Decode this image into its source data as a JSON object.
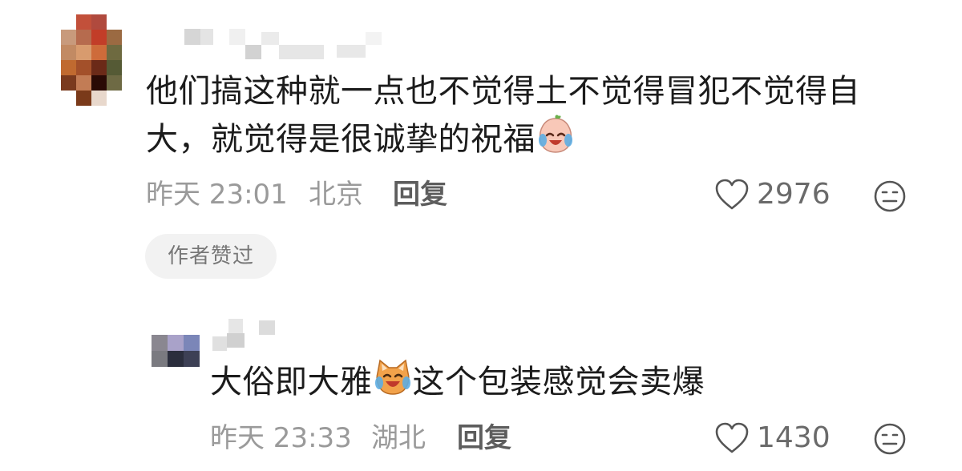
{
  "comment": {
    "text_line1": "他们搞这种就一点也不觉得土不觉得冒犯不觉得自",
    "text_line2": "大，就觉得是很诚挚的祝福",
    "emoji": "crying-laughing-peach-emoji",
    "time": "昨天 23:01",
    "location": "北京",
    "reply_label": "回复",
    "like_count": "2976",
    "author_badge": "作者赞过"
  },
  "reply": {
    "text_before_emoji": "大俗即大雅",
    "emoji": "crying-laughing-cat-emoji",
    "text_after_emoji": "这个包装感觉会卖爆",
    "time": "昨天 23:33",
    "location": "湖北",
    "reply_label": "回复",
    "like_count": "1430"
  },
  "colors": {
    "text": "#1c1c1c",
    "meta": "#9a9a9a",
    "badge_bg": "#f2f2f2"
  }
}
